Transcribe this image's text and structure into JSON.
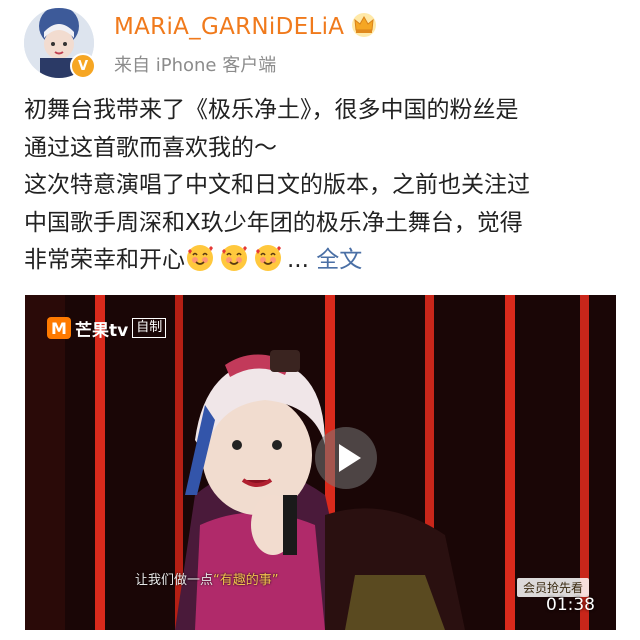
{
  "user": {
    "name": "MARiA_GARNiDELiA",
    "source": "来自 iPhone 客户端",
    "avatar_icon": "singer-avatar",
    "verified_icon": "verified-v-badge",
    "badge_icon": "crown-icon"
  },
  "post": {
    "lines": [
      "初舞台我带来了《极乐净土》，很多中国的粉丝是",
      "通过这首歌而喜欢我的～",
      "这次特意演唱了中文和日文的版本，之前也关注过",
      "中国歌手周深和X玖少年团的极乐净土舞台，觉得",
      "非常荣幸和开心"
    ],
    "emoji_icon": "smiling-face-with-hearts",
    "ellipsis": "...",
    "full_text_link": "全文"
  },
  "video": {
    "logo_mark": "M",
    "logo_text": "芒果tv",
    "logo_badge": "自制",
    "subtitle_pre": "让我们做一点",
    "subtitle_highlight": "“有趣的事”",
    "tag": "会员抢先看",
    "duration": "01:38",
    "play_icon": "play-icon",
    "colors": {
      "stage_red": "#d92a1c",
      "stage_dark": "#1a0606"
    }
  },
  "colors": {
    "username": "#f07a1c",
    "link": "#4a6fa5",
    "meta": "#8c8c8c"
  }
}
